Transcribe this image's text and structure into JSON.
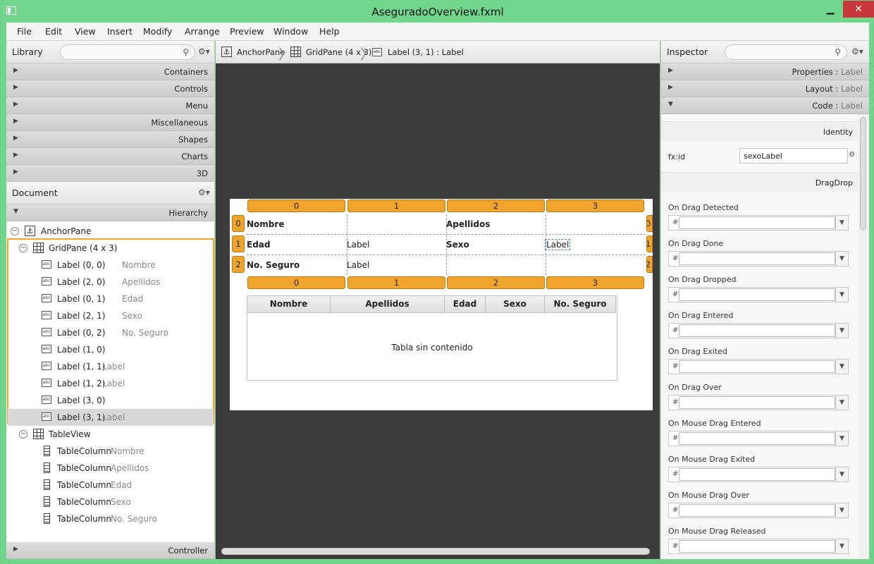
{
  "window": {
    "title": "AseguradoOverview.fxml",
    "min": "▁",
    "max": "□",
    "close": "✕"
  },
  "menu": [
    "File",
    "Edit",
    "View",
    "Insert",
    "Modify",
    "Arrange",
    "Preview",
    "Window",
    "Help"
  ],
  "library": {
    "title": "Library",
    "sections": [
      "Containers",
      "Controls",
      "Menu",
      "Miscellaneous",
      "Shapes",
      "Charts",
      "3D"
    ]
  },
  "document": {
    "title": "Document",
    "hierarchy": "Hierarchy",
    "controller": "Controller",
    "root": "AnchorPane",
    "grid": "GridPane (4 x 3)",
    "grid_children": [
      {
        "label": "Label (0, 0)",
        "text": "Nombre"
      },
      {
        "label": "Label (2, 0)",
        "text": "Apellidos"
      },
      {
        "label": "Label (0, 1)",
        "text": "Edad"
      },
      {
        "label": "Label (2, 1)",
        "text": "Sexo"
      },
      {
        "label": "Label (0, 2)",
        "text": "No. Seguro"
      },
      {
        "label": "Label (1, 0)",
        "text": ""
      },
      {
        "label": "Label (1, 1)",
        "text": "Label"
      },
      {
        "label": "Label (1, 2)",
        "text": "Label"
      },
      {
        "label": "Label (3, 0)",
        "text": ""
      },
      {
        "label": "Label (3, 1)",
        "text": "Label"
      }
    ],
    "table": "TableView",
    "columns": [
      {
        "label": "TableColumn",
        "text": "Nombre"
      },
      {
        "label": "TableColumn",
        "text": "Apellidos"
      },
      {
        "label": "TableColumn",
        "text": "Edad"
      },
      {
        "label": "TableColumn",
        "text": "Sexo"
      },
      {
        "label": "TableColumn",
        "text": "No. Seguro"
      }
    ]
  },
  "breadcrumb": [
    "AnchorPane",
    "GridPane (4 x 3)",
    "Label (3, 1) : Label"
  ],
  "canvas": {
    "col_headers": [
      "0",
      "1",
      "2",
      "3"
    ],
    "row_headers": [
      "0",
      "1",
      "2"
    ],
    "cells": {
      "nombre": "Nombre",
      "apellidos": "Apellidos",
      "edad": "Edad",
      "sexo": "Sexo",
      "seguro": "No. Seguro",
      "edad_val": "Label",
      "seguro_val": "Label",
      "sexo_val": "Label"
    },
    "table_headers": [
      "Nombre",
      "Apellidos",
      "Edad",
      "Sexo",
      "No. Seguro"
    ],
    "table_empty": "Tabla sin contenido"
  },
  "inspector": {
    "title": "Inspector",
    "sections": [
      {
        "name": "Properties",
        "sub": "Label"
      },
      {
        "name": "Layout",
        "sub": "Label"
      },
      {
        "name": "Code",
        "sub": "Label"
      }
    ],
    "identity": "Identity",
    "fxid_label": "fx:id",
    "fxid_value": "sexoLabel",
    "dragdrop": "DragDrop",
    "events": [
      "On Drag Detected",
      "On Drag Done",
      "On Drag Dropped",
      "On Drag Entered",
      "On Drag Exited",
      "On Drag Over",
      "On Mouse Drag Entered",
      "On Mouse Drag Exited",
      "On Mouse Drag Over",
      "On Mouse Drag Released"
    ]
  }
}
